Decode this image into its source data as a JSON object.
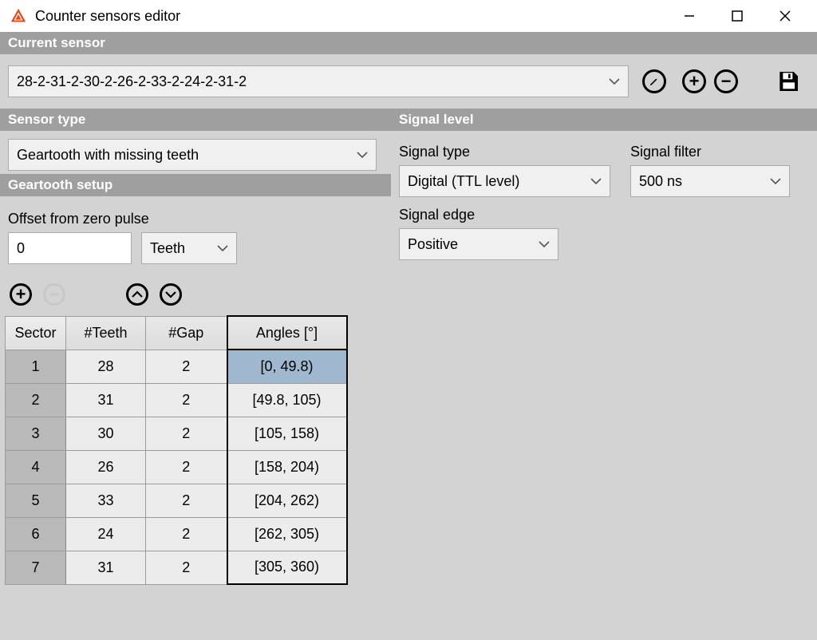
{
  "window": {
    "title": "Counter sensors editor"
  },
  "sections": {
    "current_sensor": "Current sensor",
    "sensor_type": "Sensor type",
    "signal_level": "Signal level",
    "geartooth_setup": "Geartooth setup"
  },
  "sensor_select": {
    "value": "28-2-31-2-30-2-26-2-33-2-24-2-31-2"
  },
  "sensor_type": {
    "value": "Geartooth with missing teeth"
  },
  "signal_type": {
    "label": "Signal type",
    "value": "Digital (TTL level)"
  },
  "signal_filter": {
    "label": "Signal filter",
    "value": "500 ns"
  },
  "signal_edge": {
    "label": "Signal edge",
    "value": "Positive"
  },
  "offset": {
    "label": "Offset from zero pulse",
    "value": "0",
    "unit": "Teeth"
  },
  "table": {
    "headers": {
      "sector": "Sector",
      "teeth": "#Teeth",
      "gap": "#Gap",
      "angles": "Angles [°]"
    },
    "rows": [
      {
        "sector": "1",
        "teeth": "28",
        "gap": "2",
        "angles": "[0, 49.8)"
      },
      {
        "sector": "2",
        "teeth": "31",
        "gap": "2",
        "angles": "[49.8, 105)"
      },
      {
        "sector": "3",
        "teeth": "30",
        "gap": "2",
        "angles": "[105, 158)"
      },
      {
        "sector": "4",
        "teeth": "26",
        "gap": "2",
        "angles": "[158, 204)"
      },
      {
        "sector": "5",
        "teeth": "33",
        "gap": "2",
        "angles": "[204, 262)"
      },
      {
        "sector": "6",
        "teeth": "24",
        "gap": "2",
        "angles": "[262, 305)"
      },
      {
        "sector": "7",
        "teeth": "31",
        "gap": "2",
        "angles": "[305, 360)"
      }
    ]
  }
}
